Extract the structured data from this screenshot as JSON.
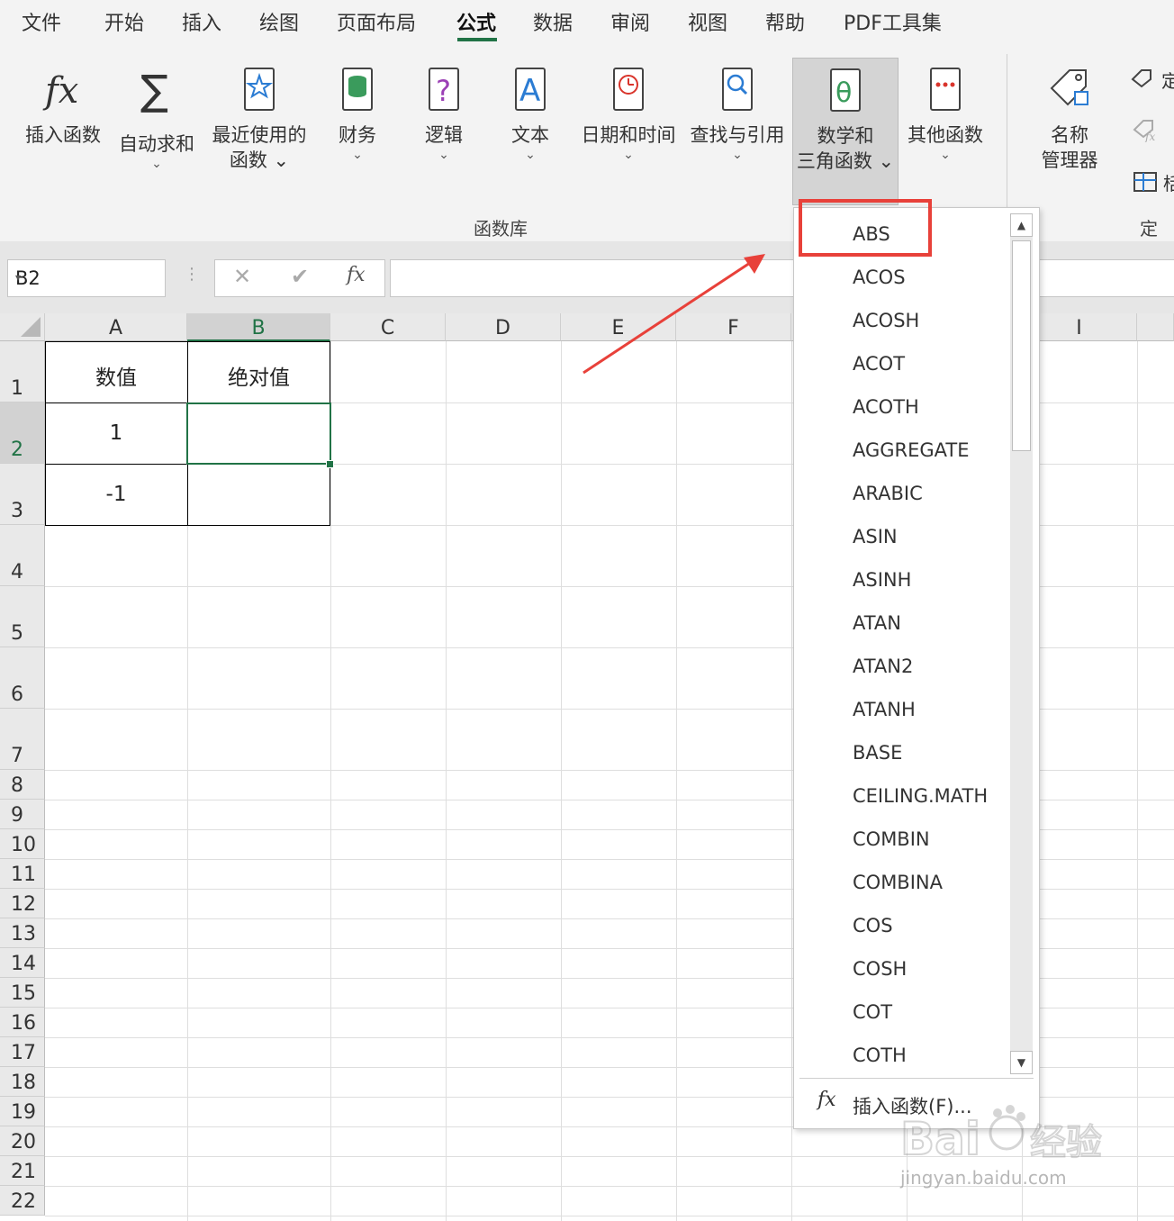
{
  "tabs": [
    "文件",
    "开始",
    "插入",
    "绘图",
    "页面布局",
    "公式",
    "数据",
    "审阅",
    "视图",
    "帮助",
    "PDF工具集"
  ],
  "active_tab": "公式",
  "ribbon": {
    "buttons": [
      {
        "label": "插入函数",
        "chev": ""
      },
      {
        "label": "自动求和",
        "chev": "⌄"
      },
      {
        "label": "最近使用的",
        "label2": "函数 ⌄"
      },
      {
        "label": "财务",
        "chev": "⌄"
      },
      {
        "label": "逻辑",
        "chev": "⌄"
      },
      {
        "label": "文本",
        "chev": "⌄"
      },
      {
        "label": "日期和时间",
        "chev": "⌄"
      },
      {
        "label": "查找与引用",
        "chev": "⌄"
      },
      {
        "label": "数学和",
        "label2": "三角函数 ⌄"
      },
      {
        "label": "其他函数",
        "chev": "⌄"
      },
      {
        "label": "名称",
        "label2": "管理器"
      }
    ],
    "group_label": "函数库",
    "group_label_2": "定义",
    "side_items": [
      "定",
      "",
      "栝"
    ]
  },
  "formula_bar": {
    "name_box": "B2",
    "name_box_dropdown": "▾",
    "dots": "⋮",
    "cancel": "✕",
    "enter": "✔",
    "fx": "fx",
    "value": ""
  },
  "grid": {
    "columns": [
      "A",
      "B",
      "C",
      "D",
      "E",
      "F",
      "",
      "",
      "",
      "I"
    ],
    "selected_column": "B",
    "rows": [
      "1",
      "2",
      "3",
      "4",
      "5",
      "6",
      "7",
      "8",
      "9",
      "10",
      "11",
      "12",
      "13",
      "14",
      "15",
      "16",
      "17",
      "18",
      "19",
      "20",
      "21",
      "22"
    ],
    "selected_row": "2",
    "cells": {
      "A1": "数值",
      "B1": "绝对值",
      "A2": "1",
      "B2": "",
      "A3": "-1",
      "B3": ""
    }
  },
  "dropdown": {
    "items": [
      "ABS",
      "ACOS",
      "ACOSH",
      "ACOT",
      "ACOTH",
      "AGGREGATE",
      "ARABIC",
      "ASIN",
      "ASINH",
      "ATAN",
      "ATAN2",
      "ATANH",
      "BASE",
      "CEILING.MATH",
      "COMBIN",
      "COMBINA",
      "COS",
      "COSH",
      "COT",
      "COTH"
    ],
    "highlighted": "ABS",
    "insert_label": "插入函数(F)...",
    "insert_icon": "fx",
    "scroll_up": "▲",
    "scroll_down": "▼"
  },
  "watermark": {
    "text": "Bai 经验",
    "url_text": "jingyan.baidu.com"
  },
  "colors": {
    "accent": "#217346",
    "annotation_red": "#e8413a",
    "ribbon_bg": "#f3f3f3"
  }
}
